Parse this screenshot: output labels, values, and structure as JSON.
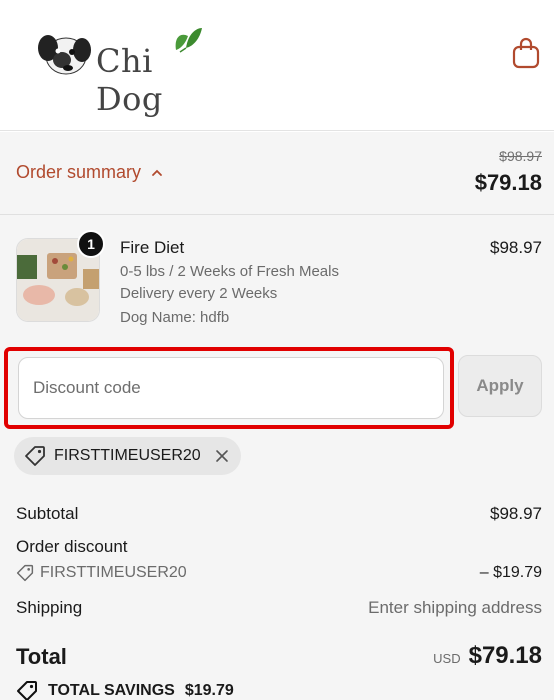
{
  "header": {
    "brand": "Chi Dog",
    "cart_icon": "shopping-bag-icon",
    "accent_color": "#b14a2e"
  },
  "summary": {
    "toggle_label": "Order summary",
    "toggle_icon": "chevron-up-icon",
    "original_price": "$98.97",
    "price": "$79.18"
  },
  "item": {
    "quantity": "1",
    "name": "Fire Diet",
    "details": [
      "0-5 lbs / 2 Weeks of Fresh Meals",
      "Delivery every 2 Weeks",
      "Dog Name: hdfb"
    ],
    "price": "$98.97"
  },
  "discount": {
    "placeholder": "Discount code",
    "value": "",
    "apply_label": "Apply",
    "applied_code": "FIRSTTIMEUSER20",
    "highlight_color": "#e10000"
  },
  "totals": {
    "subtotal_label": "Subtotal",
    "subtotal_value": "$98.97",
    "discount_label": "Order discount",
    "discount_code": "FIRSTTIMEUSER20",
    "discount_value": "– $19.79",
    "shipping_label": "Shipping",
    "shipping_value": "Enter shipping address",
    "total_label": "Total",
    "currency": "USD",
    "total_value": "$79.18",
    "savings_label": "TOTAL SAVINGS",
    "savings_value": "$19.79"
  }
}
